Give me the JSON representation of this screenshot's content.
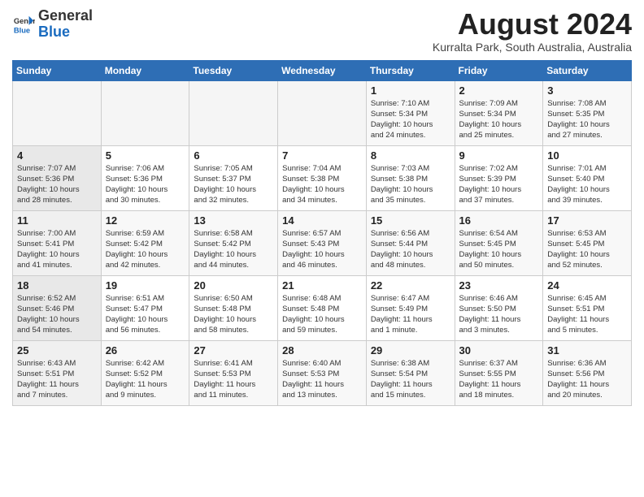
{
  "logo": {
    "general": "General",
    "blue": "Blue"
  },
  "title": {
    "month_year": "August 2024",
    "location": "Kurralta Park, South Australia, Australia"
  },
  "days_of_week": [
    "Sunday",
    "Monday",
    "Tuesday",
    "Wednesday",
    "Thursday",
    "Friday",
    "Saturday"
  ],
  "weeks": [
    [
      {
        "day": "",
        "info": ""
      },
      {
        "day": "",
        "info": ""
      },
      {
        "day": "",
        "info": ""
      },
      {
        "day": "",
        "info": ""
      },
      {
        "day": "1",
        "info": "Sunrise: 7:10 AM\nSunset: 5:34 PM\nDaylight: 10 hours\nand 24 minutes."
      },
      {
        "day": "2",
        "info": "Sunrise: 7:09 AM\nSunset: 5:34 PM\nDaylight: 10 hours\nand 25 minutes."
      },
      {
        "day": "3",
        "info": "Sunrise: 7:08 AM\nSunset: 5:35 PM\nDaylight: 10 hours\nand 27 minutes."
      }
    ],
    [
      {
        "day": "4",
        "info": "Sunrise: 7:07 AM\nSunset: 5:36 PM\nDaylight: 10 hours\nand 28 minutes."
      },
      {
        "day": "5",
        "info": "Sunrise: 7:06 AM\nSunset: 5:36 PM\nDaylight: 10 hours\nand 30 minutes."
      },
      {
        "day": "6",
        "info": "Sunrise: 7:05 AM\nSunset: 5:37 PM\nDaylight: 10 hours\nand 32 minutes."
      },
      {
        "day": "7",
        "info": "Sunrise: 7:04 AM\nSunset: 5:38 PM\nDaylight: 10 hours\nand 34 minutes."
      },
      {
        "day": "8",
        "info": "Sunrise: 7:03 AM\nSunset: 5:38 PM\nDaylight: 10 hours\nand 35 minutes."
      },
      {
        "day": "9",
        "info": "Sunrise: 7:02 AM\nSunset: 5:39 PM\nDaylight: 10 hours\nand 37 minutes."
      },
      {
        "day": "10",
        "info": "Sunrise: 7:01 AM\nSunset: 5:40 PM\nDaylight: 10 hours\nand 39 minutes."
      }
    ],
    [
      {
        "day": "11",
        "info": "Sunrise: 7:00 AM\nSunset: 5:41 PM\nDaylight: 10 hours\nand 41 minutes."
      },
      {
        "day": "12",
        "info": "Sunrise: 6:59 AM\nSunset: 5:42 PM\nDaylight: 10 hours\nand 42 minutes."
      },
      {
        "day": "13",
        "info": "Sunrise: 6:58 AM\nSunset: 5:42 PM\nDaylight: 10 hours\nand 44 minutes."
      },
      {
        "day": "14",
        "info": "Sunrise: 6:57 AM\nSunset: 5:43 PM\nDaylight: 10 hours\nand 46 minutes."
      },
      {
        "day": "15",
        "info": "Sunrise: 6:56 AM\nSunset: 5:44 PM\nDaylight: 10 hours\nand 48 minutes."
      },
      {
        "day": "16",
        "info": "Sunrise: 6:54 AM\nSunset: 5:45 PM\nDaylight: 10 hours\nand 50 minutes."
      },
      {
        "day": "17",
        "info": "Sunrise: 6:53 AM\nSunset: 5:45 PM\nDaylight: 10 hours\nand 52 minutes."
      }
    ],
    [
      {
        "day": "18",
        "info": "Sunrise: 6:52 AM\nSunset: 5:46 PM\nDaylight: 10 hours\nand 54 minutes."
      },
      {
        "day": "19",
        "info": "Sunrise: 6:51 AM\nSunset: 5:47 PM\nDaylight: 10 hours\nand 56 minutes."
      },
      {
        "day": "20",
        "info": "Sunrise: 6:50 AM\nSunset: 5:48 PM\nDaylight: 10 hours\nand 58 minutes."
      },
      {
        "day": "21",
        "info": "Sunrise: 6:48 AM\nSunset: 5:48 PM\nDaylight: 10 hours\nand 59 minutes."
      },
      {
        "day": "22",
        "info": "Sunrise: 6:47 AM\nSunset: 5:49 PM\nDaylight: 11 hours\nand 1 minute."
      },
      {
        "day": "23",
        "info": "Sunrise: 6:46 AM\nSunset: 5:50 PM\nDaylight: 11 hours\nand 3 minutes."
      },
      {
        "day": "24",
        "info": "Sunrise: 6:45 AM\nSunset: 5:51 PM\nDaylight: 11 hours\nand 5 minutes."
      }
    ],
    [
      {
        "day": "25",
        "info": "Sunrise: 6:43 AM\nSunset: 5:51 PM\nDaylight: 11 hours\nand 7 minutes."
      },
      {
        "day": "26",
        "info": "Sunrise: 6:42 AM\nSunset: 5:52 PM\nDaylight: 11 hours\nand 9 minutes."
      },
      {
        "day": "27",
        "info": "Sunrise: 6:41 AM\nSunset: 5:53 PM\nDaylight: 11 hours\nand 11 minutes."
      },
      {
        "day": "28",
        "info": "Sunrise: 6:40 AM\nSunset: 5:53 PM\nDaylight: 11 hours\nand 13 minutes."
      },
      {
        "day": "29",
        "info": "Sunrise: 6:38 AM\nSunset: 5:54 PM\nDaylight: 11 hours\nand 15 minutes."
      },
      {
        "day": "30",
        "info": "Sunrise: 6:37 AM\nSunset: 5:55 PM\nDaylight: 11 hours\nand 18 minutes."
      },
      {
        "day": "31",
        "info": "Sunrise: 6:36 AM\nSunset: 5:56 PM\nDaylight: 11 hours\nand 20 minutes."
      }
    ]
  ]
}
